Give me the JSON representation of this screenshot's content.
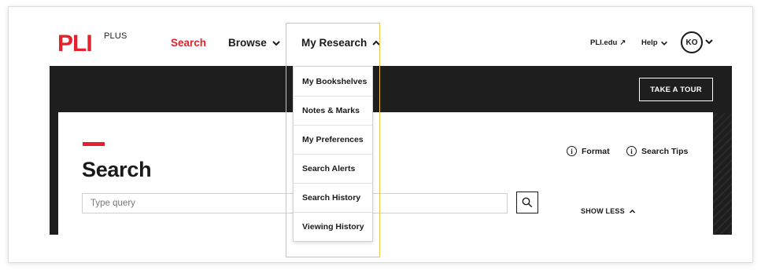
{
  "header": {
    "logo_text": "PLI",
    "logo_suffix": "PLUS",
    "nav": [
      {
        "label": "Search"
      },
      {
        "label": "Browse"
      },
      {
        "label": "My Research"
      }
    ],
    "right_links": [
      {
        "label": "PLI.edu",
        "suffix": "↗"
      },
      {
        "label": "Help"
      }
    ],
    "user_initials": "KO"
  },
  "hero": {
    "tour_label": "TAKE A TOUR"
  },
  "search_panel": {
    "title": "Search",
    "input_placeholder": "Type query",
    "format_label": "Format",
    "tips_label": "Search Tips",
    "show_less_label": "SHOW LESS"
  },
  "dropdown": {
    "items": [
      {
        "label": "My Bookshelves"
      },
      {
        "label": "Notes & Marks"
      },
      {
        "label": "My Preferences"
      },
      {
        "label": "Search Alerts"
      },
      {
        "label": "Search History"
      },
      {
        "label": "Viewing History"
      }
    ]
  },
  "colors": {
    "brand_red": "#e4222d",
    "dark_band": "#1e1e1e",
    "highlight": "#f0c64a"
  }
}
